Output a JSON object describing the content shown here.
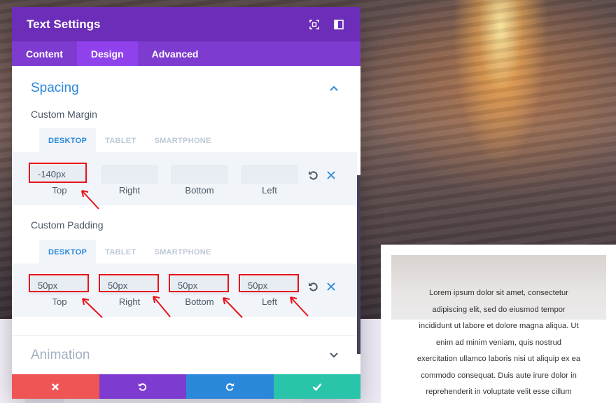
{
  "modal": {
    "title": "Text Settings",
    "tabs": [
      {
        "label": "Content",
        "active": false
      },
      {
        "label": "Design",
        "active": true
      },
      {
        "label": "Advanced",
        "active": false
      }
    ],
    "header_icons": [
      "expand-icon",
      "sidebar-toggle-icon"
    ]
  },
  "spacing": {
    "title": "Spacing",
    "custom_margin": {
      "label": "Custom Margin",
      "device_tabs": [
        "DESKTOP",
        "TABLET",
        "SMARTPHONE"
      ],
      "active_device": "DESKTOP",
      "fields": [
        {
          "caption": "Top",
          "value": "-140px"
        },
        {
          "caption": "Right",
          "value": ""
        },
        {
          "caption": "Bottom",
          "value": ""
        },
        {
          "caption": "Left",
          "value": ""
        }
      ]
    },
    "custom_padding": {
      "label": "Custom Padding",
      "device_tabs": [
        "DESKTOP",
        "TABLET",
        "SMARTPHONE"
      ],
      "active_device": "DESKTOP",
      "fields": [
        {
          "caption": "Top",
          "value": "50px"
        },
        {
          "caption": "Right",
          "value": "50px"
        },
        {
          "caption": "Bottom",
          "value": "50px"
        },
        {
          "caption": "Left",
          "value": "50px"
        }
      ]
    }
  },
  "animation": {
    "title": "Animation"
  },
  "footer": {
    "buttons": [
      {
        "name": "cancel",
        "color": "#ef5555",
        "icon": "close-icon"
      },
      {
        "name": "undo",
        "color": "#7e3bd0",
        "icon": "undo-icon"
      },
      {
        "name": "redo",
        "color": "#2b87da",
        "icon": "redo-icon"
      },
      {
        "name": "save",
        "color": "#29c4a9",
        "icon": "check-icon"
      }
    ]
  },
  "preview": {
    "text": "Lorem ipsum dolor sit amet, consectetur\nadipiscing elit, sed do eiusmod tempor\nincididunt ut labore et dolore magna aliqua. Ut\nenim ad minim veniam, quis nostrud\nexercitation ullamco laboris nisi ut aliquip ex ea\ncommodo consequat. Duis aute irure dolor in\nreprehenderit in voluptate velit esse cillum"
  },
  "colors": {
    "header": "#6c2eb9",
    "tabs_bar": "#7d3bcf",
    "active_tab": "#8f42ec",
    "accent": "#2b87da",
    "annotation": "#e8131a"
  }
}
